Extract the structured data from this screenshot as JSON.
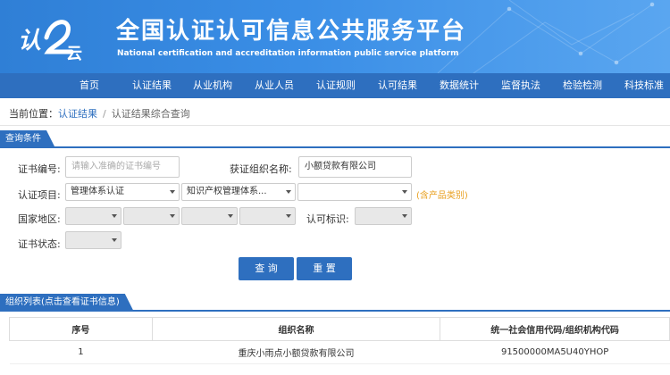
{
  "header": {
    "logo_text": "认证云",
    "title": "全国认证认可信息公共服务平台",
    "subtitle": "National certification and accreditation information public service platform"
  },
  "nav": {
    "items": [
      {
        "label": "首页"
      },
      {
        "label": "认证结果"
      },
      {
        "label": "从业机构"
      },
      {
        "label": "从业人员"
      },
      {
        "label": "认证规则"
      },
      {
        "label": "认可结果"
      },
      {
        "label": "数据统计"
      },
      {
        "label": "监督执法"
      },
      {
        "label": "检验检测"
      },
      {
        "label": "科技标准"
      }
    ]
  },
  "breadcrumb": {
    "prefix": "当前位置：",
    "link": "认证结果",
    "sep": "/",
    "current": "认证结果综合查询"
  },
  "query": {
    "section_title": "查询条件",
    "cert_no_label": "证书编号:",
    "cert_no_placeholder": "请输入准确的证书编号",
    "org_label": "获证组织名称:",
    "org_value": "小额贷款有限公司",
    "project_label": "认证项目:",
    "project_sel1": "管理体系认证",
    "project_sel2": "知识产权管理体系...",
    "project_sel3": "",
    "project_note": "(含产品类别)",
    "region_label": "国家地区:",
    "accredit_label": "认可标识:",
    "status_label": "证书状态:",
    "search_btn": "查 询",
    "reset_btn": "重 置"
  },
  "results": {
    "section_title": "组织列表(点击查看证书信息)",
    "columns": [
      "序号",
      "组织名称",
      "统一社会信用代码/组织机构代码"
    ],
    "rows": [
      [
        "1",
        "重庆小雨点小额贷款有限公司",
        "91500000MA5U40YHOP"
      ]
    ]
  },
  "colors": {
    "brand_blue": "#2e6fbf",
    "note_orange": "#e8a020"
  }
}
